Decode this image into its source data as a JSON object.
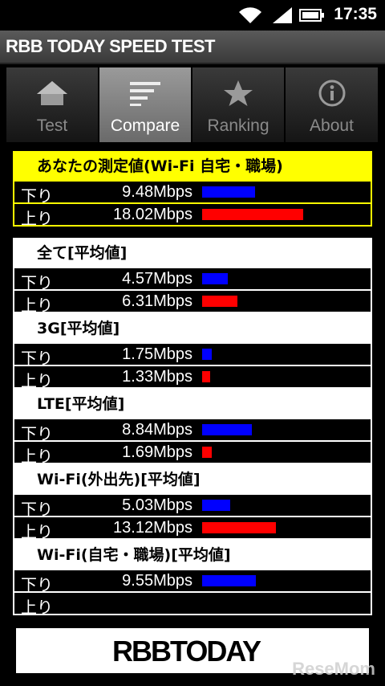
{
  "status": {
    "time": "17:35"
  },
  "app": {
    "title": "RBB TODAY SPEED TEST"
  },
  "tabs": [
    {
      "label": "Test",
      "icon": "home-icon"
    },
    {
      "label": "Compare",
      "icon": "list-icon",
      "active": true
    },
    {
      "label": "Ranking",
      "icon": "star-icon"
    },
    {
      "label": "About",
      "icon": "info-icon"
    }
  ],
  "colors": {
    "download": "#0000ff",
    "upload": "#ff0000",
    "highlight": "#ffff00"
  },
  "sections": [
    {
      "title": "あなたの測定値(Wi-Fi 自宅・職場)",
      "down_label": "下り",
      "down": "9.48Mbps",
      "down_value": 9.48,
      "up_label": "上り",
      "up": "18.02Mbps",
      "up_value": 18.02
    },
    {
      "title": "全て[平均値]",
      "down_label": "下り",
      "down": "4.57Mbps",
      "down_value": 4.57,
      "up_label": "上り",
      "up": "6.31Mbps",
      "up_value": 6.31
    },
    {
      "title": "3G[平均値]",
      "down_label": "下り",
      "down": "1.75Mbps",
      "down_value": 1.75,
      "up_label": "上り",
      "up": "1.33Mbps",
      "up_value": 1.33
    },
    {
      "title": "LTE[平均値]",
      "down_label": "下り",
      "down": "8.84Mbps",
      "down_value": 8.84,
      "up_label": "上り",
      "up": "1.69Mbps",
      "up_value": 1.69
    },
    {
      "title": "Wi-Fi(外出先)[平均値]",
      "down_label": "下り",
      "down": "5.03Mbps",
      "down_value": 5.03,
      "up_label": "上り",
      "up": "13.12Mbps",
      "up_value": 13.12
    },
    {
      "title": "Wi-Fi(自宅・職場)[平均値]",
      "down_label": "下り",
      "down": "9.55Mbps",
      "down_value": 9.55,
      "up_label": "上り",
      "up": "",
      "up_value": 0
    }
  ],
  "footer": {
    "logo": "RBBTODAY",
    "watermark": "ReseMom"
  }
}
